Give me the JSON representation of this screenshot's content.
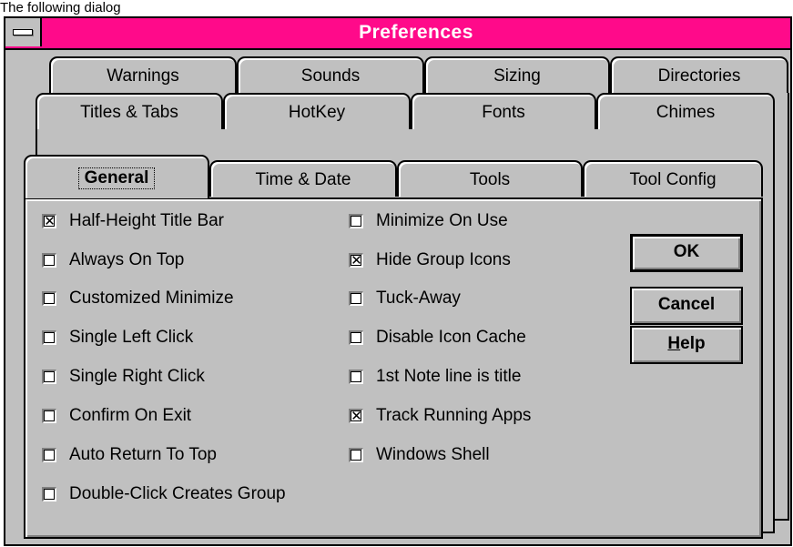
{
  "caption": "The following dialog",
  "window": {
    "title": "Preferences"
  },
  "tabs": {
    "row1": [
      "Warnings",
      "Sounds",
      "Sizing",
      "Directories"
    ],
    "row2": [
      "Titles & Tabs",
      "HotKey",
      "Fonts",
      "Chimes"
    ],
    "row3": [
      "General",
      "Time & Date",
      "Tools",
      "Tool Config"
    ],
    "active": "General"
  },
  "options": {
    "left": [
      {
        "label": "Half-Height Title Bar",
        "checked": true
      },
      {
        "label": "Always On Top",
        "checked": false
      },
      {
        "label": "Customized Minimize",
        "checked": false
      },
      {
        "label": "Single Left Click",
        "checked": false
      },
      {
        "label": "Single Right Click",
        "checked": false
      },
      {
        "label": "Confirm On Exit",
        "checked": false
      },
      {
        "label": "Auto Return To Top",
        "checked": false
      },
      {
        "label": "Double-Click Creates Group",
        "checked": false
      }
    ],
    "right": [
      {
        "label": "Minimize On Use",
        "checked": false
      },
      {
        "label": "Hide Group Icons",
        "checked": true
      },
      {
        "label": "Tuck-Away",
        "checked": false
      },
      {
        "label": "Disable Icon Cache",
        "checked": false
      },
      {
        "label": "1st Note line is title",
        "checked": false
      },
      {
        "label": "Track Running Apps",
        "checked": true
      },
      {
        "label": "Windows Shell",
        "checked": false
      }
    ]
  },
  "buttons": {
    "ok": "OK",
    "cancel": "Cancel",
    "help_mnemonic": "H",
    "help_rest": "elp"
  }
}
